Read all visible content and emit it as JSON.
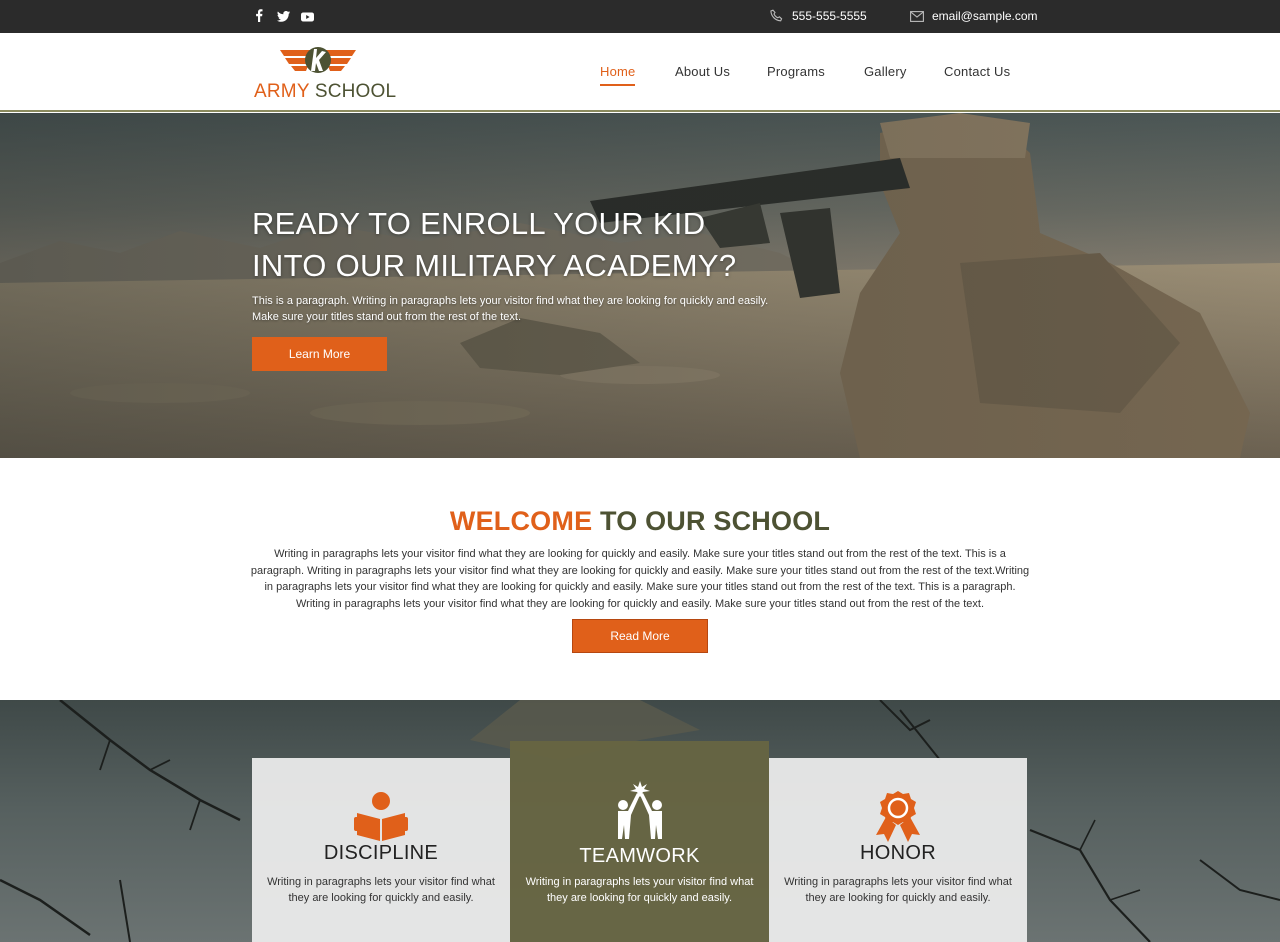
{
  "topbar": {
    "social": [
      "facebook-icon",
      "twitter-icon",
      "youtube-icon"
    ],
    "phone": "555-555-5555",
    "email": "email@sample.com"
  },
  "logo": {
    "army": "ARMY",
    "school": "SCHOOL"
  },
  "nav": {
    "items": [
      {
        "label": "Home",
        "active": true
      },
      {
        "label": "About Us",
        "active": false
      },
      {
        "label": "Programs",
        "active": false
      },
      {
        "label": "Gallery",
        "active": false
      },
      {
        "label": "Contact Us",
        "active": false
      }
    ]
  },
  "hero": {
    "title_line1": "READY TO ENROLL YOUR KID",
    "title_line2": "INTO OUR MILITARY ACADEMY?",
    "text_line1": "This is a paragraph. Writing in paragraphs lets your visitor find what they are looking for quickly and easily.",
    "text_line2": "Make sure your titles stand out from the rest of the text.",
    "button": "Learn More"
  },
  "welcome": {
    "title_accent": "WELCOME",
    "title_rest": " TO OUR SCHOOL",
    "text": "Writing in paragraphs lets your visitor find what they are looking for quickly and easily. Make sure your titles stand out from the rest of the text. This is a paragraph. Writing in paragraphs lets your visitor find what they are looking for quickly and easily. Make sure your titles stand out from the rest of the text.Writing in paragraphs lets your visitor find what they are looking for quickly and easily. Make sure your titles stand out from the rest of the text. This is a paragraph. Writing in paragraphs lets your visitor find what they are looking for quickly and easily. Make sure your titles stand out from the rest of the text.",
    "button": "Read More"
  },
  "features": [
    {
      "icon": "reading-icon",
      "title": "DISCIPLINE",
      "text": "Writing in paragraphs lets your visitor find what they are looking for quickly and easily."
    },
    {
      "icon": "high-five-icon",
      "title": "TEAMWORK",
      "text": "Writing in paragraphs lets your visitor find what they are looking for quickly and easily."
    },
    {
      "icon": "award-ribbon-icon",
      "title": "HONOR",
      "text": "Writing in paragraphs lets your visitor find what they are looking for quickly and easily."
    }
  ],
  "colors": {
    "accent": "#e0601a",
    "olive": "#4d5233",
    "olive_card": "#676542",
    "topbar": "#2b2b2b"
  }
}
